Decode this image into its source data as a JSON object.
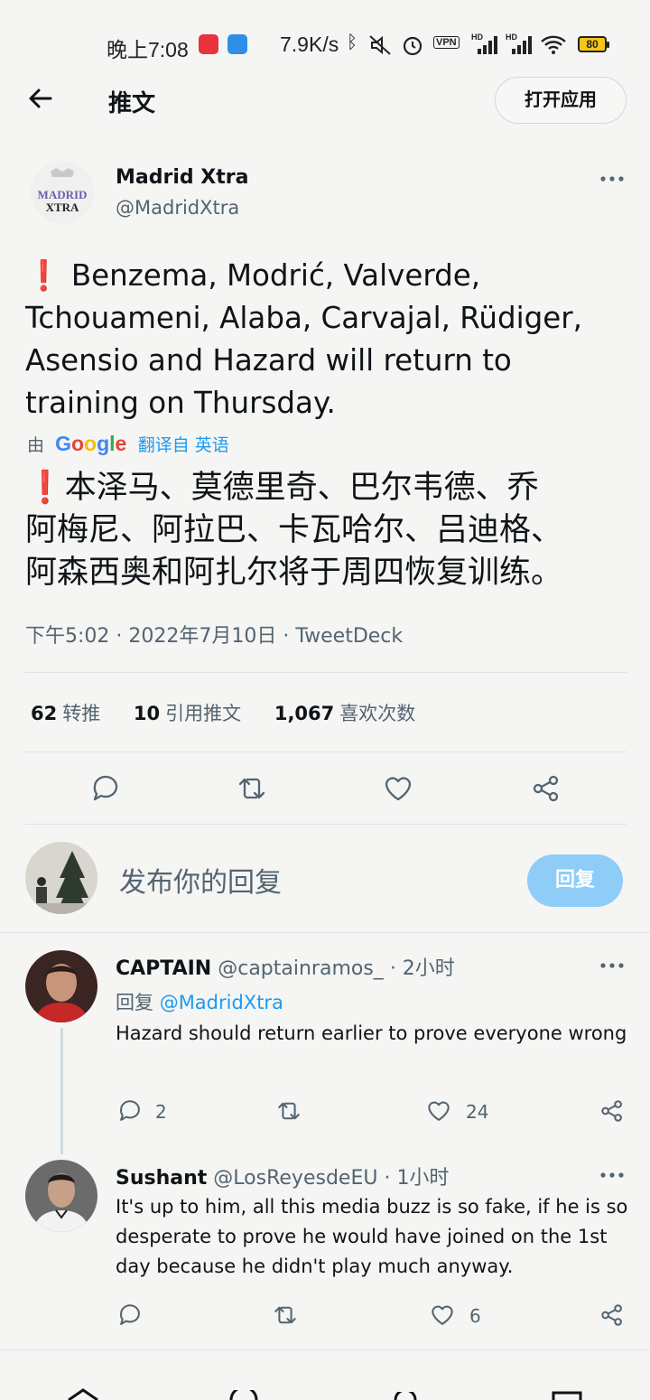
{
  "status_bar": {
    "time": "晚上7:08",
    "net_speed": "7.9K/s",
    "hd1": "HD",
    "hd2": "HD",
    "vpn": "VPN",
    "battery": "80"
  },
  "header": {
    "title": "推文",
    "open_app": "打开应用"
  },
  "tweet": {
    "author_name": "Madrid Xtra",
    "author_handle": "@MadridXtra",
    "logo_text_1": "MADRID",
    "logo_text_2": "XTRA",
    "text_line1": "Benzema, Modrić, Valverde,",
    "text_line2": "Tchouameni, Alaba, Carvajal, Rüdiger,",
    "text_line3": "Asensio and Hazard will return to",
    "text_line4": "training on Thursday.",
    "translated_by": "由",
    "google": "Google",
    "translate_from": "翻译自 英语",
    "translated_line1": "本泽马、莫德里奇、巴尔韦德、乔",
    "translated_line2": "阿梅尼、阿拉巴、卡瓦哈尔、吕迪格、",
    "translated_line3": "阿森西奥和阿扎尔将于周四恢复训练。",
    "meta": "下午5:02 · 2022年7月10日 · TweetDeck",
    "retweets_count": "62",
    "retweets_label": "转推",
    "quotes_count": "10",
    "quotes_label": "引用推文",
    "likes_count": "1,067",
    "likes_label": "喜欢次数"
  },
  "compose": {
    "placeholder": "发布你的回复",
    "button": "回复"
  },
  "replies": [
    {
      "name": "CAPTAIN",
      "handle": "@captainramos_",
      "time": "· 2小时",
      "reply_prefix": "回复",
      "reply_to": "@MadridXtra",
      "body": "Hazard should return earlier to prove everyone wrong",
      "reply_count": "2",
      "like_count": "24"
    },
    {
      "name": "Sushant",
      "handle": "@LosReyesdeEU",
      "time": "· 1小时",
      "body": "It's up to him, all this media buzz is so fake, if he is so desperate to prove he would have joined on the 1st day because he didn't play much anyway.",
      "like_count": "6"
    }
  ],
  "colors": {
    "accent": "#1d9bf0",
    "reply_button": "#8ecdf7",
    "exclamation": "#e0102a",
    "muted": "#536471",
    "background": "#f5f5f3"
  }
}
